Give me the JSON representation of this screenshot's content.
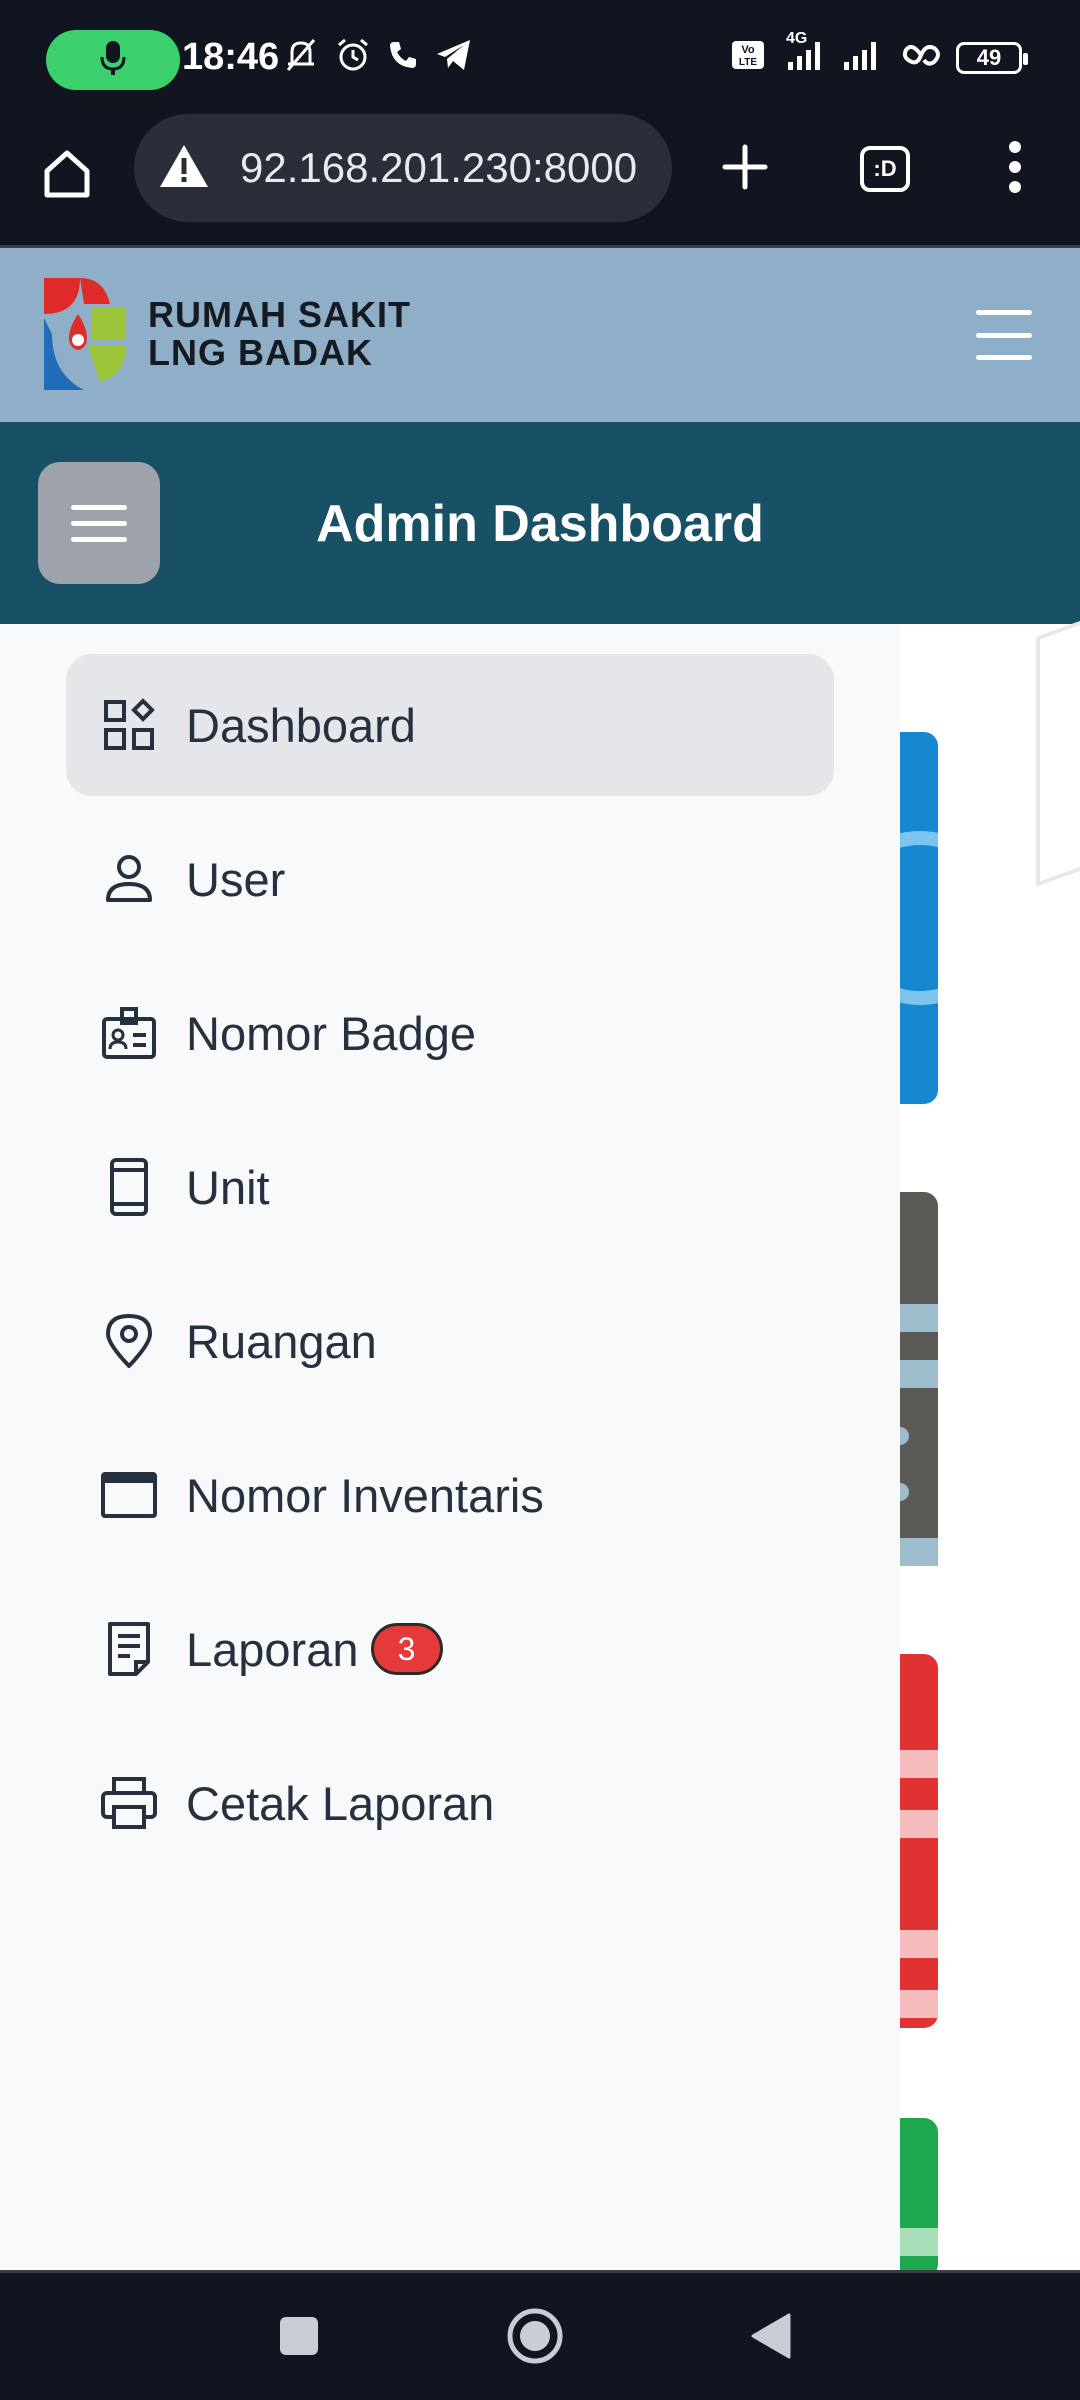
{
  "status_bar": {
    "time": "18:46",
    "battery": "49",
    "network": "4G",
    "icons": [
      "mic-icon",
      "mute-icon",
      "alarm-icon",
      "call-icon",
      "telegram-icon",
      "volte-icon",
      "signal-icon",
      "signal-icon",
      "hotspot-icon",
      "battery-icon"
    ]
  },
  "browser": {
    "url": "92.168.201.230:8000",
    "tabs_label": ":D",
    "icons": [
      "home-icon",
      "warning-icon",
      "plus-icon",
      "tabs-icon",
      "more-vert-icon"
    ]
  },
  "site": {
    "brand_line1": "RUMAH SAKIT",
    "brand_line2": "LNG BADAK"
  },
  "admin_bar": {
    "title": "Admin Dashboard"
  },
  "sidebar": {
    "items": [
      {
        "label": "Dashboard",
        "icon": "dashboard-icon",
        "active": true
      },
      {
        "label": "User",
        "icon": "user-icon"
      },
      {
        "label": "Nomor Badge",
        "icon": "badge-id-icon"
      },
      {
        "label": "Unit",
        "icon": "device-icon"
      },
      {
        "label": "Ruangan",
        "icon": "location-pin-icon"
      },
      {
        "label": "Nomor Inventaris",
        "icon": "window-icon"
      },
      {
        "label": "Laporan",
        "icon": "report-icon",
        "badge": "3"
      },
      {
        "label": "Cetak Laporan",
        "icon": "printer-icon"
      }
    ]
  },
  "colors": {
    "header_bg": "#8fafc8",
    "admin_bar_bg": "#185165",
    "sidebar_bg": "#f8f9fb",
    "active_item_bg": "#e5e6ea",
    "badge_bg": "#e53a3a",
    "card_blue": "#1588cf",
    "card_gray": "#5b5a57",
    "card_red": "#e03232",
    "card_green": "#1fa84d"
  }
}
